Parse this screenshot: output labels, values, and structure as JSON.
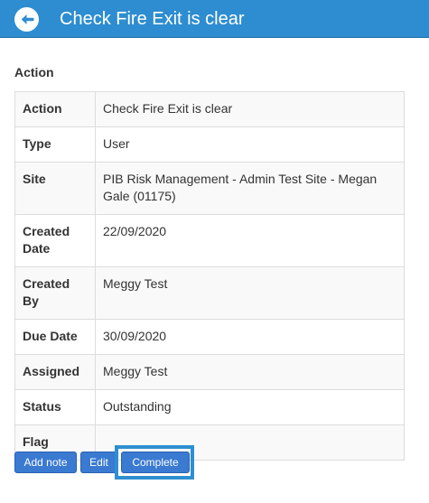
{
  "header": {
    "back_icon": "arrow-left-icon",
    "title": "Check Fire Exit is clear",
    "color": "#2d8dd0"
  },
  "section": {
    "heading": "Action"
  },
  "details": [
    {
      "label": "Action",
      "value": "Check Fire Exit is clear"
    },
    {
      "label": "Type",
      "value": "User"
    },
    {
      "label": "Site",
      "value": "PIB Risk Management - Admin Test Site - Megan Gale (01175)"
    },
    {
      "label": "Created Date",
      "value": "22/09/2020"
    },
    {
      "label": "Created By",
      "value": "Meggy Test"
    },
    {
      "label": "Due Date",
      "value": "30/09/2020"
    },
    {
      "label": "Assigned",
      "value": "Meggy Test"
    },
    {
      "label": "Status",
      "value": "Outstanding"
    },
    {
      "label": "Flag",
      "value": ""
    }
  ],
  "actions": {
    "add_note": "Add note",
    "edit": "Edit",
    "complete": "Complete",
    "button_color": "#3a7ad1",
    "focused": "complete"
  }
}
